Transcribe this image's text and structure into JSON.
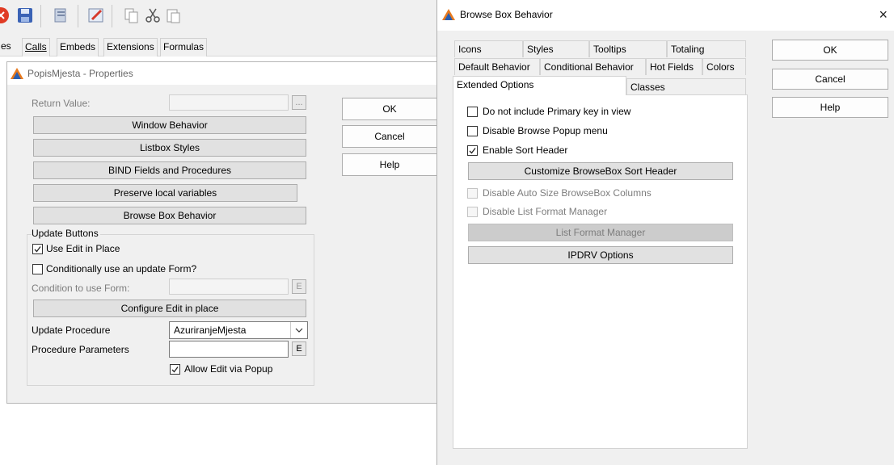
{
  "toolbar": {
    "icons": [
      "close-circle-icon",
      "save-icon",
      "print-preview-icon",
      "edit-icon",
      "copy-icon",
      "cut-icon",
      "paste-icon"
    ]
  },
  "top_tabs": [
    {
      "label": "es"
    },
    {
      "label": "Calls"
    },
    {
      "label": "Embeds"
    },
    {
      "label": "Extensions"
    },
    {
      "label": "Formulas"
    }
  ],
  "properties": {
    "title": "PopisMjesta - Properties",
    "return_value_label": "Return Value:",
    "ellipsis": "...",
    "buttons": {
      "window_behavior": "Window Behavior",
      "listbox_styles": "Listbox Styles",
      "bind_fields": "BIND Fields and Procedures",
      "preserve_local": "Preserve local variables",
      "browse_box_behavior": "Browse Box Behavior",
      "configure_edit": "Configure Edit in place"
    },
    "side_buttons": {
      "ok": "OK",
      "cancel": "Cancel",
      "help": "Help"
    },
    "update_buttons_group": "Update Buttons",
    "use_edit_in_place": {
      "label": "Use Edit in Place",
      "checked": true
    },
    "conditionally_use_form": {
      "label": "Conditionally use an update Form?",
      "checked": false
    },
    "condition_label": "Condition to use Form:",
    "e_button": "E",
    "update_procedure_label": "Update Procedure",
    "update_procedure_value": "AzuriranjeMjesta",
    "procedure_parameters_label": "Procedure Parameters",
    "procedure_parameters_value": "",
    "allow_edit_via_popup": {
      "label": "Allow Edit via Popup",
      "checked": true
    }
  },
  "dialog": {
    "title": "Browse Box Behavior",
    "close": "×",
    "tabs_row1": [
      "Icons",
      "Styles",
      "Tooltips",
      "Totaling"
    ],
    "tabs_row2": [
      "Default Behavior",
      "Conditional Behavior",
      "Hot Fields",
      "Colors"
    ],
    "tabs_row3": [
      "Extended Options",
      "Classes"
    ],
    "options": {
      "no_primary_key": {
        "label": "Do not include Primary key in view",
        "checked": false,
        "enabled": true
      },
      "disable_popup": {
        "label": "Disable Browse Popup menu",
        "checked": false,
        "enabled": true
      },
      "enable_sort_header": {
        "label": "Enable Sort Header",
        "checked": true,
        "enabled": true
      },
      "customize_sort_header": "Customize BrowseBox Sort Header",
      "disable_auto_size": {
        "label": "Disable Auto Size BrowseBox Columns",
        "checked": false,
        "enabled": false
      },
      "disable_list_format": {
        "label": "Disable List Format Manager",
        "checked": false,
        "enabled": false
      },
      "list_format_manager": "List Format Manager",
      "ipdrv_options": "IPDRV Options"
    },
    "buttons": {
      "ok": "OK",
      "cancel": "Cancel",
      "help": "Help"
    }
  }
}
